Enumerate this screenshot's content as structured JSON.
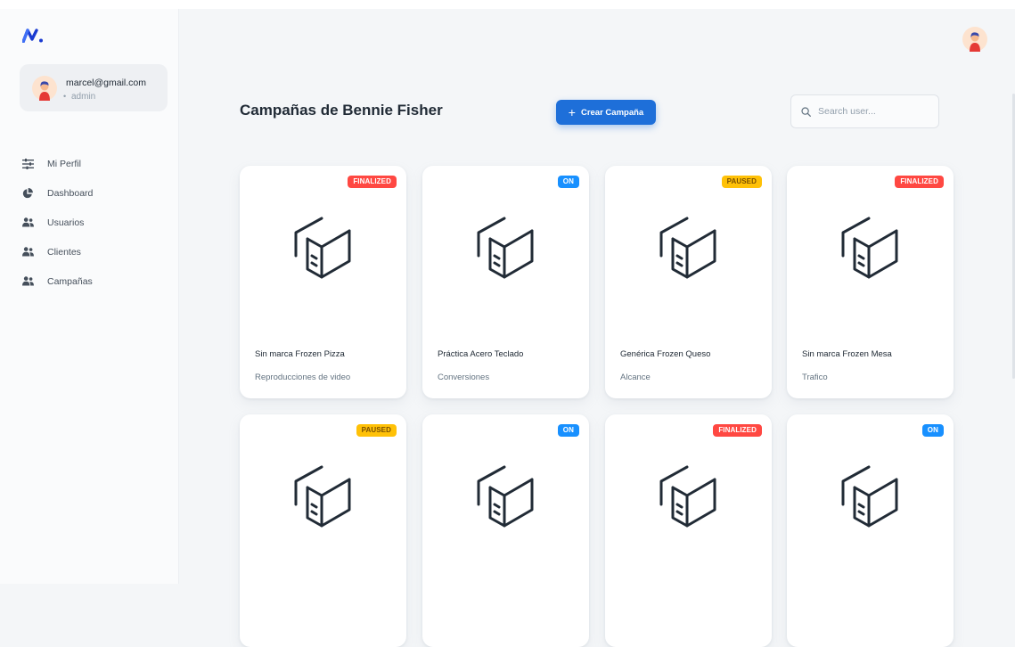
{
  "user": {
    "email": "marcel@gmail.com",
    "role": "admin"
  },
  "sidebar": {
    "items": [
      {
        "label": "Mi Perfil",
        "icon": "sliders-icon"
      },
      {
        "label": "Dashboard",
        "icon": "pie-chart-icon"
      },
      {
        "label": "Usuarios",
        "icon": "people-icon"
      },
      {
        "label": "Clientes",
        "icon": "people-icon"
      },
      {
        "label": "Campañas",
        "icon": "people-icon"
      }
    ]
  },
  "main": {
    "title": "Campañas de Bennie Fisher",
    "create_button_label": "Crear Campaña",
    "search_placeholder": "Search user..."
  },
  "colors": {
    "primary": "#1e6fd9",
    "finalized": "#ff4842",
    "on": "#1890ff",
    "paused": "#ffc107"
  },
  "campaigns": [
    {
      "status": "FINALIZED",
      "name": "Sin marca Frozen Pizza",
      "objective": "Reproducciones de video"
    },
    {
      "status": "ON",
      "name": "Práctica Acero Teclado",
      "objective": "Conversiones"
    },
    {
      "status": "PAUSED",
      "name": "Genérica Frozen Queso",
      "objective": "Alcance"
    },
    {
      "status": "FINALIZED",
      "name": "Sin marca Frozen Mesa",
      "objective": "Trafico"
    },
    {
      "status": "PAUSED",
      "name": "",
      "objective": ""
    },
    {
      "status": "ON",
      "name": "",
      "objective": ""
    },
    {
      "status": "FINALIZED",
      "name": "",
      "objective": ""
    },
    {
      "status": "ON",
      "name": "",
      "objective": ""
    }
  ]
}
